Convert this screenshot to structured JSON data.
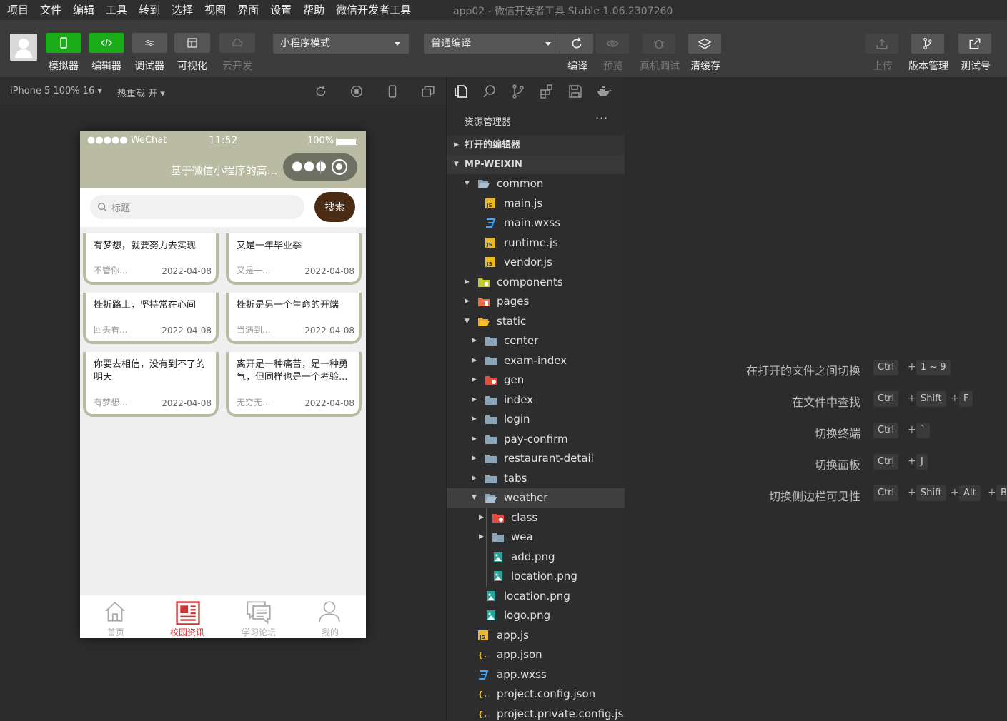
{
  "menubar": {
    "items": [
      "项目",
      "文件",
      "编辑",
      "工具",
      "转到",
      "选择",
      "视图",
      "界面",
      "设置",
      "帮助",
      "微信开发者工具"
    ],
    "app_title": "app02 - 微信开发者工具 Stable 1.06.2307260"
  },
  "toolbar": {
    "simulator": "模拟器",
    "editor": "编辑器",
    "debugger": "调试器",
    "visual": "可视化",
    "cloud": "云开发",
    "mode_select": "小程序模式",
    "compile_select": "普通编译",
    "compile": "编译",
    "preview": "预览",
    "real_debug": "真机调试",
    "clear_cache": "清缓存",
    "upload": "上传",
    "version": "版本管理",
    "test_account": "测试号"
  },
  "subbar": {
    "device": "iPhone 5 100% 16 ▾",
    "hot_reload": "热重载 开 ▾"
  },
  "phone": {
    "status": {
      "signal": "●●●●● WeChat",
      "time": "11:52",
      "battery": "100%"
    },
    "nav_title": "基于微信小程序的高...",
    "search_placeholder": "标题",
    "search_button": "搜索",
    "cards": [
      {
        "title": "有梦想，就要努力去实现",
        "snippet": "不管你...",
        "date": "2022-04-08"
      },
      {
        "title": "又是一年毕业季",
        "snippet": "又是一...",
        "date": "2022-04-08"
      },
      {
        "title": "挫折路上，坚持常在心间",
        "snippet": "回头看...",
        "date": "2022-04-08"
      },
      {
        "title": "挫折是另一个生命的开端",
        "snippet": "当遇到...",
        "date": "2022-04-08"
      },
      {
        "title": "你要去相信，没有到不了的明天",
        "snippet": "有梦想...",
        "date": "2022-04-08"
      },
      {
        "title": "离开是一种痛苦，是一种勇气，但同样也是一个考验...",
        "snippet": "无穷无...",
        "date": "2022-04-08"
      }
    ],
    "tabs": [
      {
        "label": "首页",
        "icon": "home-icon"
      },
      {
        "label": "校园资讯",
        "icon": "news-icon"
      },
      {
        "label": "学习论坛",
        "icon": "forum-icon"
      },
      {
        "label": "我的",
        "icon": "user-icon"
      }
    ]
  },
  "explorer": {
    "title": "资源管理器",
    "more": "···",
    "open_editors": "打开的编辑器",
    "project": "MP-WEIXIN",
    "tree": [
      {
        "name": "common",
        "type": "folder-open",
        "depth": 1
      },
      {
        "name": "main.js",
        "type": "js",
        "depth": 2
      },
      {
        "name": "main.wxss",
        "type": "css",
        "depth": 2
      },
      {
        "name": "runtime.js",
        "type": "js",
        "depth": 2
      },
      {
        "name": "vendor.js",
        "type": "js",
        "depth": 2
      },
      {
        "name": "components",
        "type": "folder-components",
        "depth": 1
      },
      {
        "name": "pages",
        "type": "folder-pages",
        "depth": 1
      },
      {
        "name": "static",
        "type": "folder-static",
        "depth": 1
      },
      {
        "name": "center",
        "type": "folder",
        "depth": 2
      },
      {
        "name": "exam-index",
        "type": "folder",
        "depth": 2
      },
      {
        "name": "gen",
        "type": "folder-red",
        "depth": 2
      },
      {
        "name": "index",
        "type": "folder",
        "depth": 2
      },
      {
        "name": "login",
        "type": "folder",
        "depth": 2
      },
      {
        "name": "pay-confirm",
        "type": "folder",
        "depth": 2
      },
      {
        "name": "restaurant-detail",
        "type": "folder",
        "depth": 2
      },
      {
        "name": "tabs",
        "type": "folder",
        "depth": 2
      },
      {
        "name": "weather",
        "type": "folder-open",
        "depth": 2
      },
      {
        "name": "class",
        "type": "folder-red",
        "depth": 3
      },
      {
        "name": "wea",
        "type": "folder",
        "depth": 3
      },
      {
        "name": "add.png",
        "type": "image",
        "depth": 3
      },
      {
        "name": "location.png",
        "type": "image",
        "depth": 3
      },
      {
        "name": "location.png",
        "type": "image",
        "depth": 2
      },
      {
        "name": "logo.png",
        "type": "image",
        "depth": 2
      },
      {
        "name": "app.js",
        "type": "js",
        "depth": 1
      },
      {
        "name": "app.json",
        "type": "json",
        "depth": 1
      },
      {
        "name": "app.wxss",
        "type": "css",
        "depth": 1
      },
      {
        "name": "project.config.json",
        "type": "json",
        "depth": 1
      },
      {
        "name": "project.private.config.js...",
        "type": "json",
        "depth": 1
      }
    ]
  },
  "shortcuts": [
    {
      "label": "在打开的文件之间切换",
      "keys": [
        "Ctrl",
        "1 ~ 9"
      ]
    },
    {
      "label": "在文件中查找",
      "keys": [
        "Ctrl",
        "Shift",
        "F"
      ]
    },
    {
      "label": "切换终端",
      "keys": [
        "Ctrl",
        "`"
      ]
    },
    {
      "label": "切换面板",
      "keys": [
        "Ctrl",
        "J"
      ]
    },
    {
      "label": "切换侧边栏可见性",
      "keys": [
        "Ctrl",
        "Shift",
        "Alt",
        "B"
      ]
    }
  ],
  "colors": {
    "accent_green": "#1aad19",
    "nav_olive": "#b9bba3",
    "search_brown": "#4a2b14",
    "active_tab": "#cc3333"
  }
}
